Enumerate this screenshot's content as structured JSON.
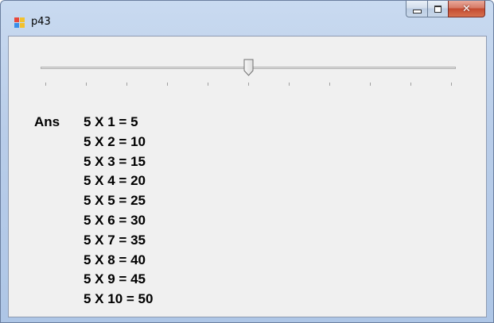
{
  "window": {
    "title": "p43",
    "icon": "windows-forms-app-icon",
    "caption_buttons": [
      "minimize",
      "maximize",
      "close"
    ]
  },
  "trackbar": {
    "value": 5,
    "min": 0,
    "max": 10,
    "tick_count": 11
  },
  "answer": {
    "label": "Ans",
    "lines": [
      "5 X 1 = 5",
      "5 X 2 = 10",
      "5 X 3 = 15",
      "5 X 4 = 20",
      "5 X 5 = 25",
      "5 X 6 = 30",
      "5 X 7 = 35",
      "5 X 8 = 40",
      "5 X 9 = 45",
      "5 X 10 = 50"
    ]
  }
}
